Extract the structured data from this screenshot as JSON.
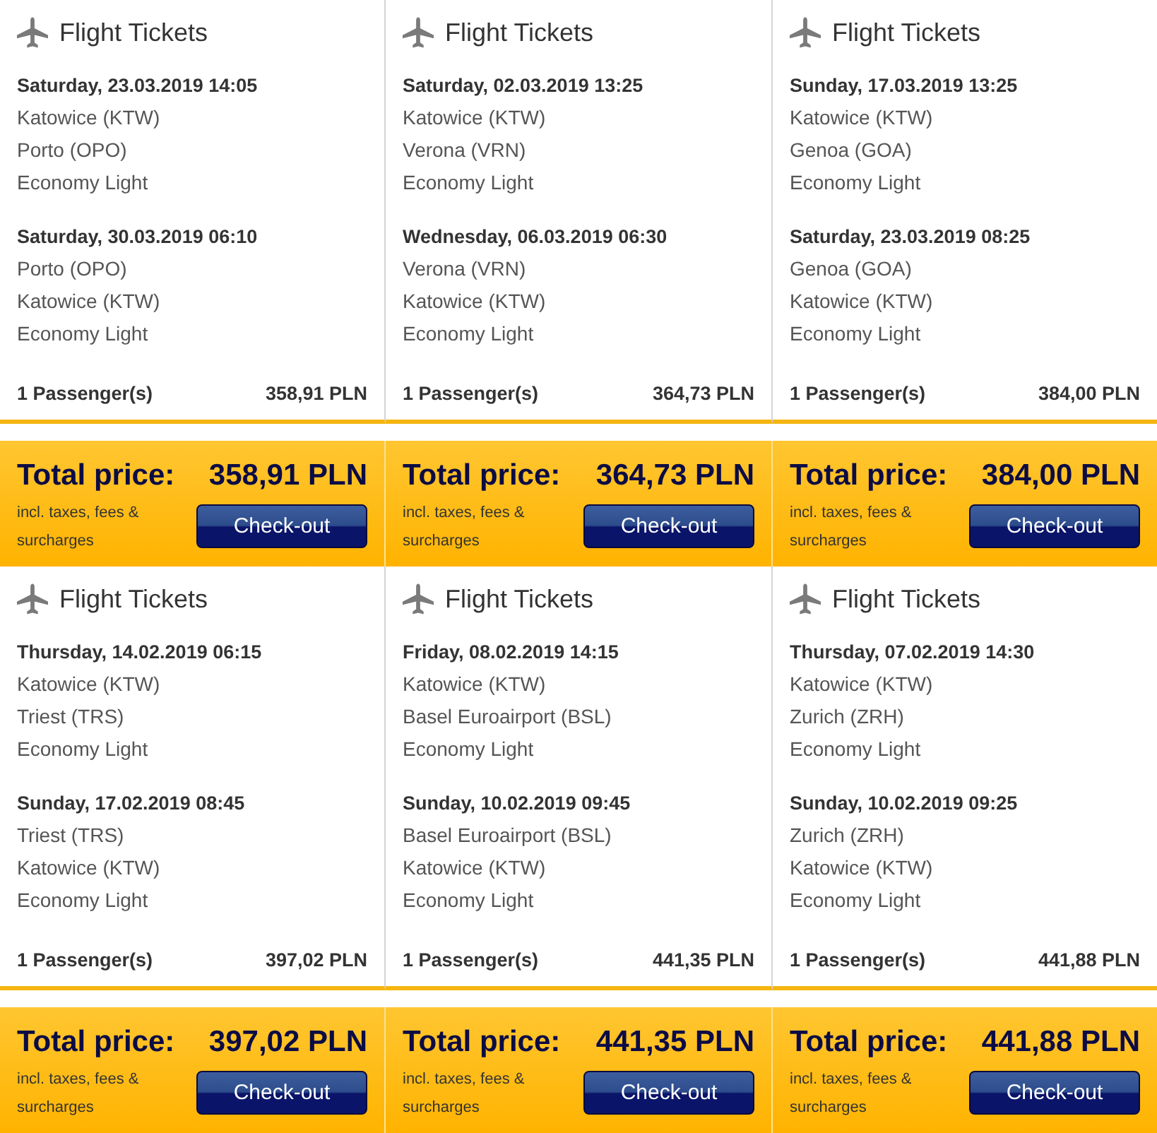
{
  "offers": [
    {
      "title": "Flight Tickets",
      "flights": [
        {
          "date": "Saturday, 23.03.2019 14:05",
          "from": "Katowice (KTW)",
          "to": "Porto (OPO)",
          "fare": "Economy Light"
        },
        {
          "date": "Saturday, 30.03.2019 06:10",
          "from": "Porto (OPO)",
          "to": "Katowice (KTW)",
          "fare": "Economy Light"
        }
      ],
      "passengers": "1 Passenger(s)",
      "subtotal": "358,91 PLN",
      "total_label": "Total price:",
      "total": "358,91 PLN",
      "note": "incl. taxes, fees & surcharges",
      "button": "Check-out"
    },
    {
      "title": "Flight Tickets",
      "flights": [
        {
          "date": "Saturday, 02.03.2019 13:25",
          "from": "Katowice (KTW)",
          "to": "Verona (VRN)",
          "fare": "Economy Light"
        },
        {
          "date": "Wednesday, 06.03.2019 06:30",
          "from": "Verona (VRN)",
          "to": "Katowice (KTW)",
          "fare": "Economy Light"
        }
      ],
      "passengers": "1 Passenger(s)",
      "subtotal": "364,73 PLN",
      "total_label": "Total price:",
      "total": "364,73 PLN",
      "note": "incl. taxes, fees & surcharges",
      "button": "Check-out"
    },
    {
      "title": "Flight Tickets",
      "flights": [
        {
          "date": "Sunday, 17.03.2019 13:25",
          "from": "Katowice (KTW)",
          "to": "Genoa (GOA)",
          "fare": "Economy Light"
        },
        {
          "date": "Saturday, 23.03.2019 08:25",
          "from": "Genoa (GOA)",
          "to": "Katowice (KTW)",
          "fare": "Economy Light"
        }
      ],
      "passengers": "1 Passenger(s)",
      "subtotal": "384,00 PLN",
      "total_label": "Total price:",
      "total": "384,00 PLN",
      "note": "incl. taxes, fees & surcharges",
      "button": "Check-out"
    },
    {
      "title": "Flight Tickets",
      "flights": [
        {
          "date": "Thursday, 14.02.2019 06:15",
          "from": "Katowice (KTW)",
          "to": "Triest (TRS)",
          "fare": "Economy Light"
        },
        {
          "date": "Sunday, 17.02.2019 08:45",
          "from": "Triest (TRS)",
          "to": "Katowice (KTW)",
          "fare": "Economy Light"
        }
      ],
      "passengers": "1 Passenger(s)",
      "subtotal": "397,02 PLN",
      "total_label": "Total price:",
      "total": "397,02 PLN",
      "note": "incl. taxes, fees & surcharges",
      "button": "Check-out"
    },
    {
      "title": "Flight Tickets",
      "flights": [
        {
          "date": "Friday, 08.02.2019 14:15",
          "from": "Katowice (KTW)",
          "to": "Basel Euroairport (BSL)",
          "fare": "Economy Light"
        },
        {
          "date": "Sunday, 10.02.2019 09:45",
          "from": "Basel Euroairport (BSL)",
          "to": "Katowice (KTW)",
          "fare": "Economy Light"
        }
      ],
      "passengers": "1 Passenger(s)",
      "subtotal": "441,35 PLN",
      "total_label": "Total price:",
      "total": "441,35 PLN",
      "note": "incl. taxes, fees & surcharges",
      "button": "Check-out"
    },
    {
      "title": "Flight Tickets",
      "flights": [
        {
          "date": "Thursday, 07.02.2019 14:30",
          "from": "Katowice (KTW)",
          "to": "Zurich (ZRH)",
          "fare": "Economy Light"
        },
        {
          "date": "Sunday, 10.02.2019 09:25",
          "from": "Zurich (ZRH)",
          "to": "Katowice (KTW)",
          "fare": "Economy Light"
        }
      ],
      "passengers": "1 Passenger(s)",
      "subtotal": "441,88 PLN",
      "total_label": "Total price:",
      "total": "441,88 PLN",
      "note": "incl. taxes, fees & surcharges",
      "button": "Check-out"
    }
  ]
}
